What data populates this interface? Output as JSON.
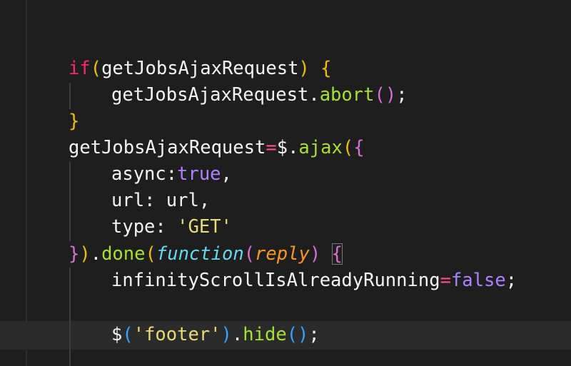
{
  "colors": {
    "background": "#1e1e1e",
    "current_line": "#2b2b2b",
    "keyword": "#f92672",
    "function": "#a6e22e",
    "boolean": "#ae81ff",
    "string": "#e6db74",
    "function_keyword": "#66d9ef",
    "parameter": "#fd971f",
    "bracket_yellow": "#f0c000",
    "bracket_magenta": "#da70d6",
    "bracket_blue": "#3aa0ff"
  },
  "code": {
    "line1": {
      "kw_if": "if",
      "lparen": "(",
      "ident": "getJobsAjaxRequest",
      "rparen": ")",
      "space": " ",
      "lbrace": "{"
    },
    "line2": {
      "ident": "getJobsAjaxRequest",
      "dot": ".",
      "method": "abort",
      "lparen": "(",
      "rparen": ")",
      "semi": ";"
    },
    "line3": {
      "rbrace": "}"
    },
    "line4": {
      "ident": "getJobsAjaxRequest",
      "assign": "=",
      "jquery": "$",
      "dot": ".",
      "method": "ajax",
      "lparen": "(",
      "lbrace": "{"
    },
    "line5": {
      "key": "async",
      "colon": ":",
      "value": "true",
      "comma": ","
    },
    "line6": {
      "key": "url",
      "colon": ": ",
      "value": "url",
      "comma": ","
    },
    "line7": {
      "key": "type",
      "colon": ": ",
      "value": "'GET'"
    },
    "line8": {
      "rbrace": "}",
      "rparen": ")",
      "dot": ".",
      "method": "done",
      "lparen": "(",
      "fkw": "function",
      "plparen": "(",
      "param": "reply",
      "prparen": ")",
      "space": " ",
      "lbrace": "{"
    },
    "line9": {
      "ident": "infinityScrollIsAlreadyRunning",
      "assign": "=",
      "value": "false",
      "semi": ";"
    },
    "line11": {
      "jquery": "$",
      "lparen": "(",
      "str": "'footer'",
      "rparen": ")",
      "dot": ".",
      "method": "hide",
      "clparen": "(",
      "crparen": ")",
      "semi": ";"
    }
  }
}
